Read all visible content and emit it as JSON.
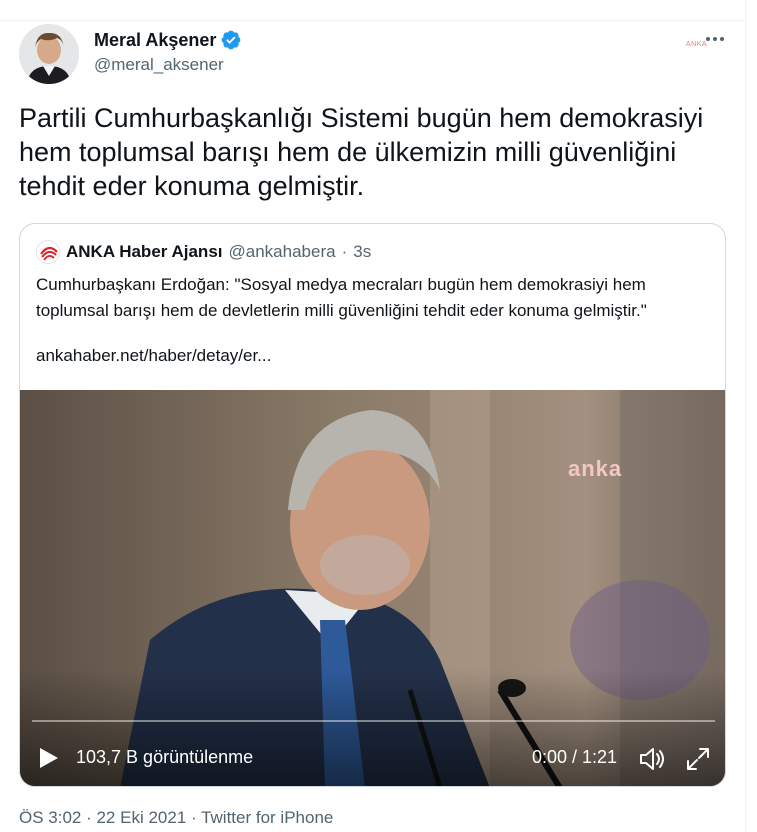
{
  "author": {
    "name": "Meral Akşener",
    "handle": "@meral_aksener"
  },
  "tweet": {
    "text": "Partili Cumhurbaşkanlığı Sistemi bugün hem demokrasiyi hem toplumsal barışı hem de ülkemizin milli güvenliğini tehdit eder konuma gelmiştir."
  },
  "quote": {
    "name": "ANKA Haber Ajansı",
    "handle": "@ankahabera",
    "separator": "·",
    "age": "3s",
    "text": "Cumhurbaşkanı Erdoğan: \"Sosyal medya mecraları bugün hem demokrasiyi hem toplumsal barışı hem de devletlerin milli güvenliğini tehdit eder konuma gelmiştir.\"",
    "link": "ankahaber.net/haber/detay/er..."
  },
  "video": {
    "overlay_text": "anka",
    "views": "103,7 B görüntülenme",
    "time": "0:00 / 1:21",
    "progress": 0
  },
  "footer": {
    "text": "ÖS 3:02 · 22 Eki 2021 · Twitter for iPhone"
  },
  "icons": {
    "verified": "verified-badge-icon",
    "more": "more-options-icon",
    "play": "play-icon",
    "volume": "volume-icon",
    "fullscreen": "fullscreen-icon"
  },
  "colors": {
    "verified_blue": "#1d9bf0",
    "secondary_text": "#536471",
    "border": "#cfd9de",
    "anka_red": "#e0222a"
  }
}
